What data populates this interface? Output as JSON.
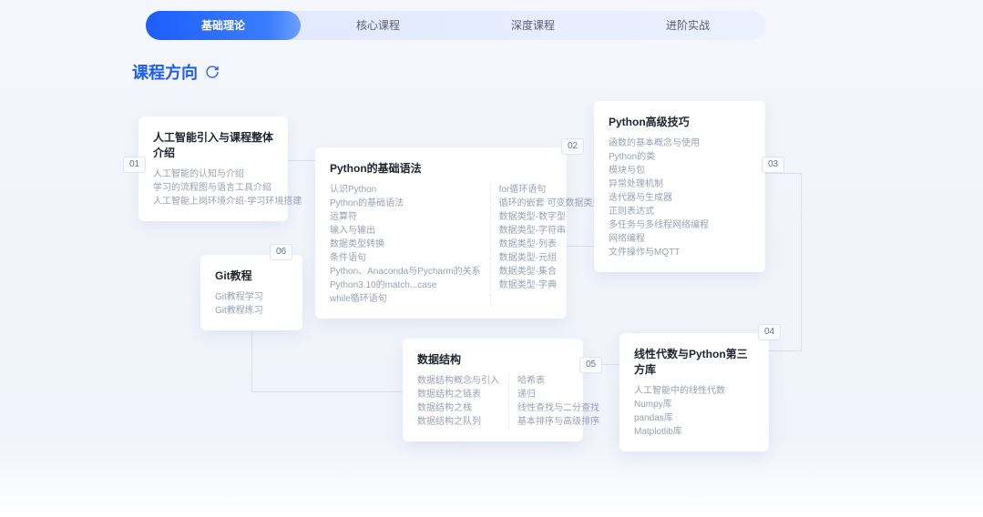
{
  "tabs": [
    {
      "label": "基础理论",
      "active": true
    },
    {
      "label": "核心课程",
      "active": false
    },
    {
      "label": "深度课程",
      "active": false
    },
    {
      "label": "进阶实战",
      "active": false
    }
  ],
  "section_title": "课程方向",
  "badges": {
    "n01": "01",
    "n02": "02",
    "n03": "03",
    "n04": "04",
    "n05": "05",
    "n06": "06"
  },
  "cards": {
    "c1": {
      "title": "人工智能引入与课程整体介绍",
      "items": [
        "人工智能的认知与介绍",
        "学习的流程图与语言工具介绍",
        "人工智能上岗环境介绍-学习环境搭建"
      ]
    },
    "c2": {
      "title": "Python的基础语法",
      "col1": [
        "认识Python",
        "Python的基础语法",
        "运算符",
        "输入与输出",
        "数据类型转换",
        "条件语句",
        "Python、Anaconda与Pycharm的关系",
        "Python3.10的match...case",
        "while循环语句"
      ],
      "col2": [
        "for循环语句",
        "循环的嵌套 可变数据类型",
        "数据类型-数字型",
        "数据类型-字符串",
        "数据类型-列表",
        "数据类型-元组",
        "数据类型-集合",
        "数据类型-字典"
      ]
    },
    "c3": {
      "title": "Python高级技巧",
      "items": [
        "函数的基本概念与使用",
        "Python的类",
        "模块与包",
        "异常处理机制",
        "迭代器与生成器",
        "正则表达式",
        "多任务与多线程网络编程",
        "网络编程",
        "文件操作与MQTT"
      ]
    },
    "c4": {
      "title": "线性代数与Python第三方库",
      "items": [
        "人工智能中的线性代数",
        "Numpy库",
        "pandas库",
        "Matplotlib库"
      ]
    },
    "c5": {
      "title": "数据结构",
      "col1": [
        "数据结构概念与引入",
        "数据结构之链表",
        "数据结构之栈",
        "数据结构之队列"
      ],
      "col2": [
        "哈希表",
        "递归",
        "线性查找与二分查找",
        "基本排序与高级排序"
      ]
    },
    "c6": {
      "title": "Git教程",
      "items": [
        "Git教程学习",
        "Git教程练习"
      ]
    }
  }
}
